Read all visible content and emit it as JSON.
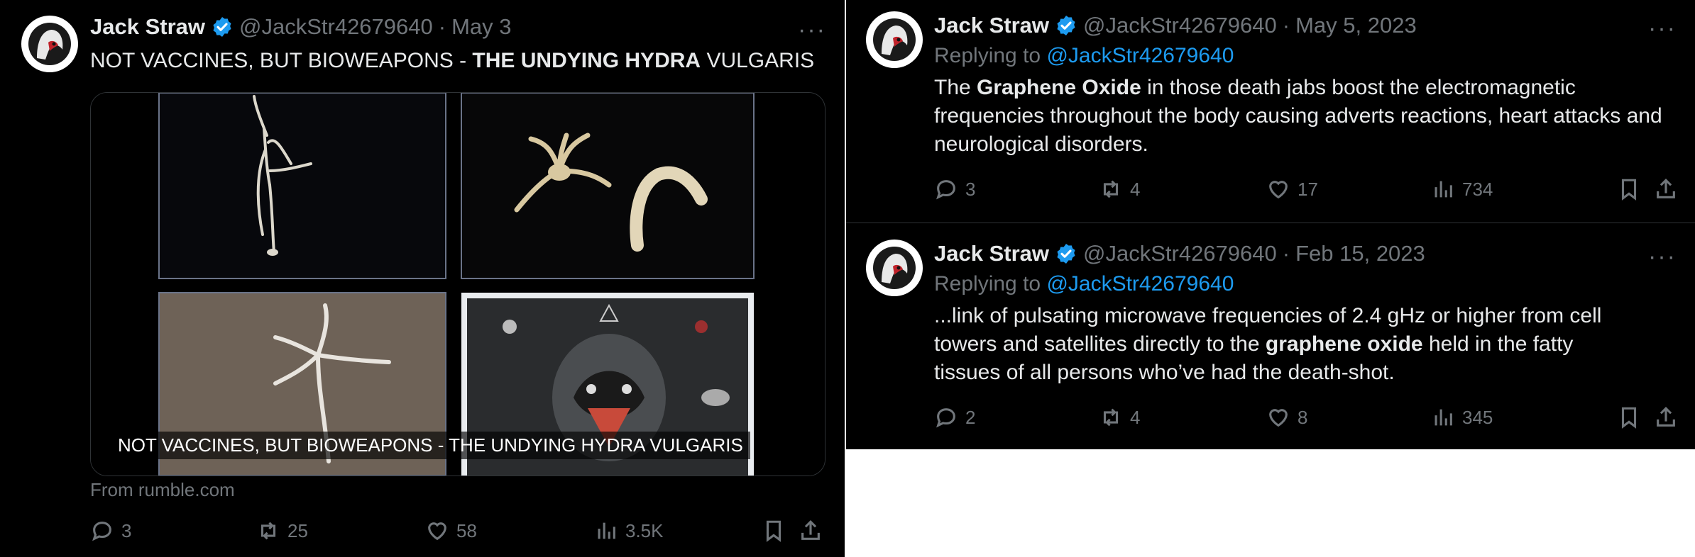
{
  "colors": {
    "background": "#000000",
    "text": "#e7e9ea",
    "muted": "#71767b",
    "accent": "#1d9bf0",
    "divider": "#2f3336"
  },
  "left_tweet": {
    "author": {
      "name": "Jack Straw",
      "handle": "@JackStr42679640",
      "date": "May 3",
      "separator": "·",
      "avatar_icon": "hooded-figure-avatar",
      "verified_icon": "verified-badge-icon"
    },
    "more_label": "···",
    "text": {
      "part1": "NOT VACCINES, BUT BIOWEAPONS - ",
      "bold": "THE UNDYING HYDRA",
      "part2": " VULGARIS"
    },
    "media": {
      "caption": "NOT VACCINES, BUT BIOWEAPONS - THE UNDYING HYDRA VULGARIS",
      "source": "From rumble.com"
    },
    "actions": {
      "replies": "3",
      "retweets": "25",
      "likes": "58",
      "views": "3.5K"
    }
  },
  "right_tweets": [
    {
      "author": {
        "name": "Jack Straw",
        "handle": "@JackStr42679640",
        "date": "May 5, 2023",
        "separator": "·"
      },
      "more_label": "···",
      "replying_to": {
        "prefix": "Replying to ",
        "mention": "@JackStr42679640"
      },
      "text": {
        "part1": "The ",
        "bold": "Graphene Oxide",
        "part2": " in those death jabs boost the electromagnetic frequencies throughout the body causing adverts reactions, heart attacks and neurological disorders."
      },
      "actions": {
        "replies": "3",
        "retweets": "4",
        "likes": "17",
        "views": "734"
      }
    },
    {
      "author": {
        "name": "Jack Straw",
        "handle": "@JackStr42679640",
        "date": "Feb 15, 2023",
        "separator": "·"
      },
      "more_label": "···",
      "replying_to": {
        "prefix": "Replying to ",
        "mention": "@JackStr42679640"
      },
      "text": {
        "part1": "...link of pulsating microwave frequencies of 2.4 gHz or higher from cell towers and satellites directly to the ",
        "bold": "graphene oxide",
        "part2": " held in the fatty tissues of all persons who’ve had the death-shot."
      },
      "actions": {
        "replies": "2",
        "retweets": "4",
        "likes": "8",
        "views": "345"
      }
    }
  ]
}
